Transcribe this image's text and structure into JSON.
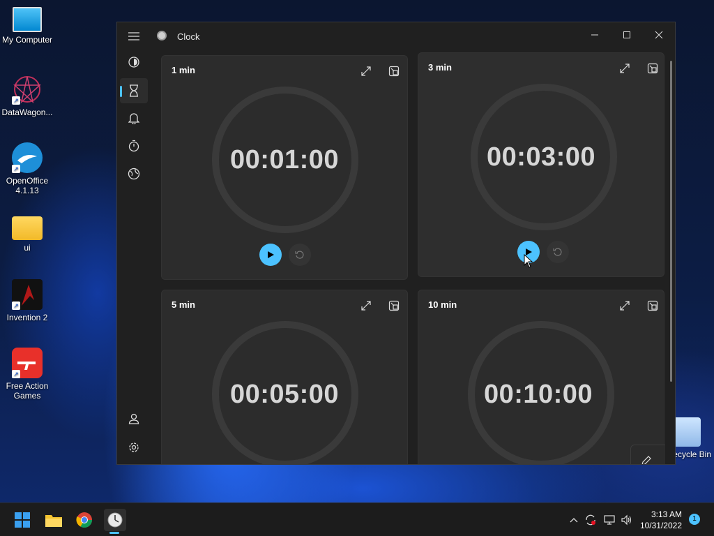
{
  "desktop": {
    "icons": [
      {
        "label": "My Computer"
      },
      {
        "label": "DataWagon..."
      },
      {
        "label": "OpenOffice 4.1.13"
      },
      {
        "label": "ui"
      },
      {
        "label": "Invention 2"
      },
      {
        "label": "Free Action Games"
      },
      {
        "label": "Recycle Bin"
      }
    ]
  },
  "window": {
    "title": "Clock",
    "icon": "clock-icon"
  },
  "nav": {
    "items": [
      {
        "name": "menu-icon"
      },
      {
        "name": "focus-sessions-icon"
      },
      {
        "name": "timer-icon"
      },
      {
        "name": "alarm-icon"
      },
      {
        "name": "stopwatch-icon"
      },
      {
        "name": "world-clock-icon"
      },
      {
        "name": "account-icon"
      },
      {
        "name": "settings-icon"
      }
    ],
    "active": "timer-icon"
  },
  "timers": [
    {
      "name": "1 min",
      "time": "00:01:00"
    },
    {
      "name": "3 min",
      "time": "00:03:00"
    },
    {
      "name": "5 min",
      "time": "00:05:00"
    },
    {
      "name": "10 min",
      "time": "00:10:00"
    }
  ],
  "taskbar": {
    "time": "3:13 AM",
    "date": "10/31/2022",
    "notifications": "1"
  },
  "colors": {
    "accent": "#4cc2ff",
    "window_bg": "#202020",
    "card_bg": "#2c2c2c"
  }
}
